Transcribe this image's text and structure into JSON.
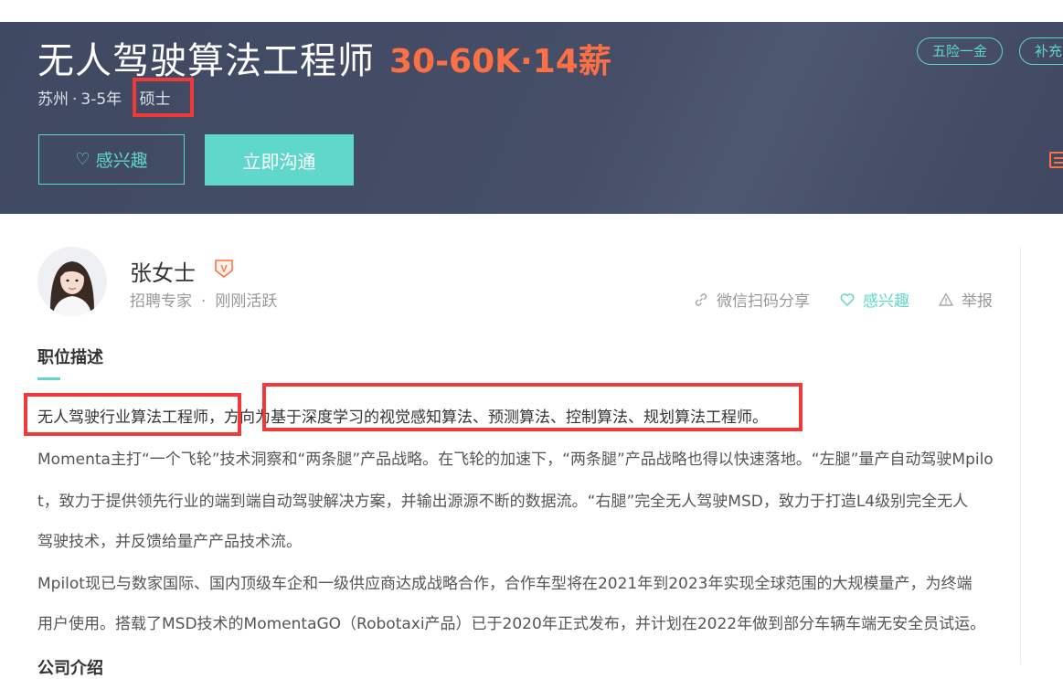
{
  "job": {
    "title": "无人驾驶算法工程师",
    "salary": "30-60K·14薪",
    "city": "苏州",
    "experience": "3-5年",
    "degree": "硕士",
    "interest_label": "感兴趣",
    "chat_label": "立即沟通",
    "welfare_tags": [
      "五险一金",
      "补充"
    ]
  },
  "recruiter": {
    "name": "张女士",
    "role": "招聘专家",
    "status": "刚刚活跃",
    "verified_badge": "V",
    "actions": {
      "share": "微信扫码分享",
      "like": "感兴趣",
      "report": "举报"
    }
  },
  "description": {
    "section_title": "职位描述",
    "first_line": "无人驾驶行业算法工程师，方向为基于深度学习的视觉感知算法、预测算法、控制算法、规划算法工程师。",
    "paragraph_lines": [
      "Momenta主打“一个飞轮”技术洞察和“两条腿”产品战略。在飞轮的加速下，“两条腿”产品战略也得以快速落地。“左腿”量产自动驾驶Mpilo",
      "t，致力于提供领先行业的端到端自动驾驶解决方案，并输出源源不断的数据流。“右腿”完全无人驾驶MSD，致力于打造L4级别完全无人",
      "驾驶技术，并反馈给量产产品技术流。",
      "Mpilot现已与数家国际、国内顶级车企和一级供应商达成战略合作，合作车型将在2021年到2023年实现全球范围的大规模量产，为终端",
      "用户使用。搭载了MSD技术的MomentaGO（Robotaxi产品）已于2020年正式发布，并计划在2022年做到部分车辆车端无安全员试运。"
    ],
    "next_section_title": "公司介绍"
  },
  "colors": {
    "accent": "#5fd7cb",
    "salary": "#fd6f45",
    "banner": "#454e66",
    "highlight": "#f03a3a"
  },
  "icons": [
    "heart-icon",
    "verified-badge-icon",
    "link-icon",
    "heart-outline-icon",
    "warning-icon",
    "document-icon"
  ]
}
